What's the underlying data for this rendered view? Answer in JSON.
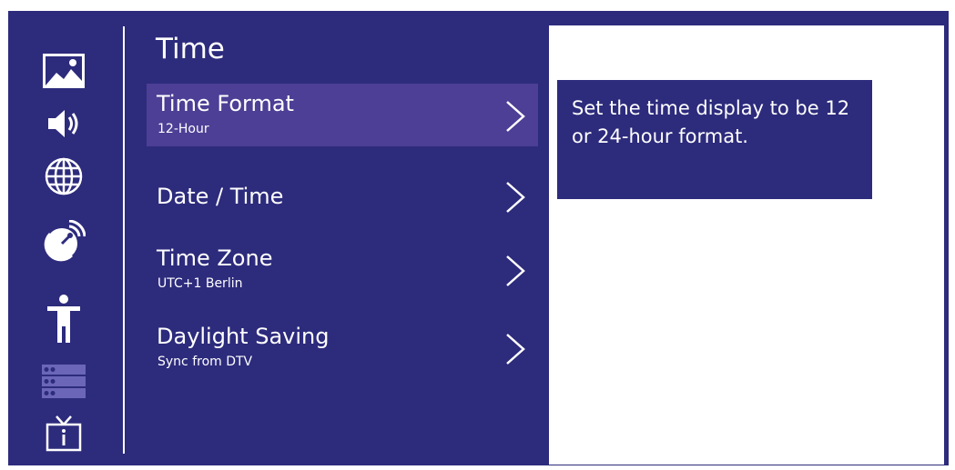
{
  "menu": {
    "title": "Time",
    "items": [
      {
        "label": "Time Format",
        "value": "12-Hour"
      },
      {
        "label": "Date / Time",
        "value": ""
      },
      {
        "label": "Time Zone",
        "value": "UTC+1 Berlin"
      },
      {
        "label": "Daylight Saving",
        "value": "Sync from DTV"
      }
    ],
    "selected_index": 0
  },
  "help": {
    "text": "Set the time display to be 12 or 24-hour format."
  },
  "sidebar": {
    "icons": [
      "picture-icon",
      "sound-icon",
      "network-icon",
      "satellite-icon",
      "accessibility-icon",
      "channel-list-icon",
      "tv-info-icon"
    ]
  },
  "colors": {
    "background": "#2d2b7c",
    "selected_item": "#4c3f95",
    "panel": "#ffffff",
    "text": "#ffffff"
  }
}
